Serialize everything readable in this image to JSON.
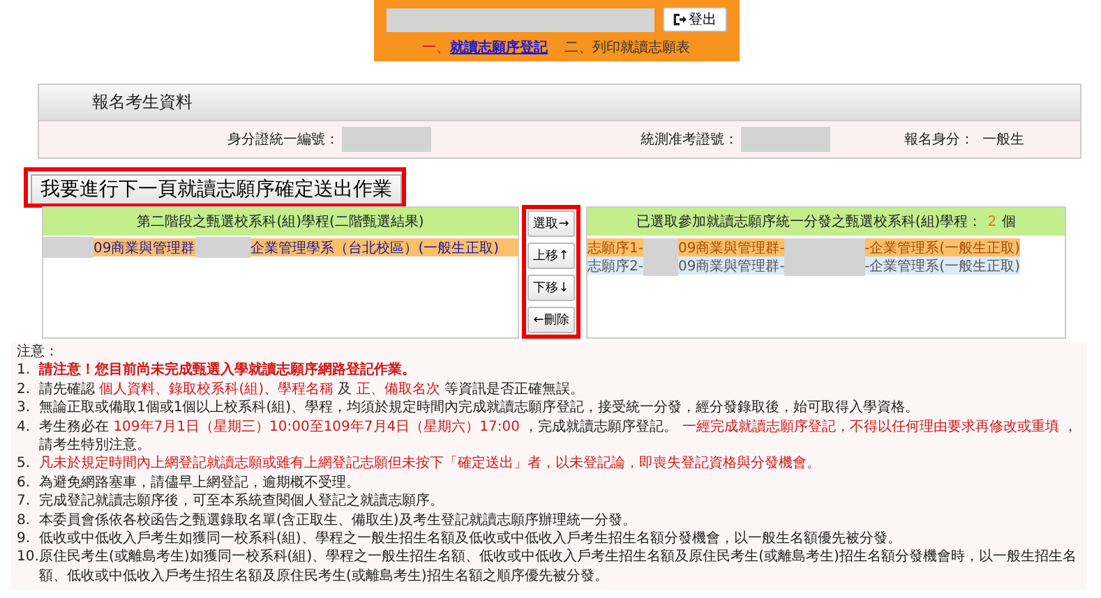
{
  "header": {
    "logout_button": "登出",
    "nav": [
      {
        "number": "一、",
        "label": "就讀志願序登記",
        "selected": true
      },
      {
        "number": "二、",
        "label": "列印就讀志願表",
        "selected": false
      }
    ]
  },
  "profile": {
    "title": "報名考生資料",
    "fields": [
      {
        "label": "身分證統一編號：",
        "redacted": true
      },
      {
        "label": "統測准考證號：",
        "redacted": true
      },
      {
        "label": "報名身分：",
        "value": "一般生",
        "redacted": false
      }
    ]
  },
  "confirm_button": "我要進行下一頁就讀志願序確定送出作業",
  "screening_results": {
    "header": "第二階段之甄選校系科(組)學程(二階甄選結果)",
    "rows": [
      {
        "group": "09商業與管理群",
        "department": "企業管理學系（台北校區）(一般生正取)",
        "selected": true
      }
    ]
  },
  "actions": [
    {
      "label": "選取→"
    },
    {
      "label": "上移↑"
    },
    {
      "label": "下移↓"
    },
    {
      "label": "←刪除"
    }
  ],
  "selected_list": {
    "header": "已選取參加就讀志願序統一分發之甄選校系科(組)學程：",
    "count": "2",
    "count_unit": "個",
    "rows": [
      {
        "prefix": "志願序1-",
        "group": "09商業與管理群-",
        "department": "-企業管理系(一般生正取)",
        "selected": true
      },
      {
        "prefix": "志願序2-",
        "group": "09商業與管理群-",
        "department": "-企業管理系(一般生正取)",
        "selected": false
      }
    ]
  },
  "notes": {
    "title": "注意：",
    "items": [
      {
        "number": "1.",
        "kind": "alert",
        "parts": [
          {
            "text": "請注意！您目前尚未完成甄選入學就讀志願序網路登記作業。",
            "highlight": true
          }
        ]
      },
      {
        "number": "2.",
        "kind": "plain",
        "parts": [
          {
            "text": "請先確認 ",
            "highlight": false
          },
          {
            "text": "個人資料、錄取校系科(組)、學程名稱",
            "highlight": true
          },
          {
            "text": " 及 ",
            "highlight": false
          },
          {
            "text": "正、備取名次",
            "highlight": true
          },
          {
            "text": " 等資訊是否正確無誤。",
            "highlight": false
          }
        ]
      },
      {
        "number": "3.",
        "kind": "plain",
        "parts": [
          {
            "text": "無論正取或備取1個或1個以上校系科(組)、學程，均須於規定時間內完成就讀志願序登記，接受統一分發，經分發錄取後，始可取得入學資格。",
            "highlight": false
          }
        ]
      },
      {
        "number": "4.",
        "kind": "plain",
        "parts": [
          {
            "text": "考生務必在 ",
            "highlight": false
          },
          {
            "text": "109年7月1日（星期三）10:00至109年7月4日（星期六）17:00",
            "highlight": true
          },
          {
            "text": " ，完成就讀志願序登記。 ",
            "highlight": false
          },
          {
            "text": "一經完成就讀志願序登記，不得以任何理由要求再修改或重填",
            "highlight": true
          },
          {
            "text": " ，請考生特別注意。",
            "highlight": false
          }
        ]
      },
      {
        "number": "5.",
        "kind": "plain",
        "parts": [
          {
            "text": "凡未於規定時間內上網登記就讀志願或雖有上網登記志願但未按下「確定送出」者，以未登記論，即喪失登記資格與分發機會。",
            "highlight": true
          }
        ]
      },
      {
        "number": "6.",
        "kind": "plain",
        "parts": [
          {
            "text": "為避免網路塞車，請儘早上網登記，逾期概不受理。",
            "highlight": false
          }
        ]
      },
      {
        "number": "7.",
        "kind": "plain",
        "parts": [
          {
            "text": "完成登記就讀志願序後，可至本系統查閱個人登記之就讀志願序。",
            "highlight": false
          }
        ]
      },
      {
        "number": "8.",
        "kind": "plain",
        "parts": [
          {
            "text": "本委員會係依各校函告之甄選錄取名單(含正取生、備取生)及考生登記就讀志願序辦理統一分發。",
            "highlight": false
          }
        ]
      },
      {
        "number": "9.",
        "kind": "plain",
        "parts": [
          {
            "text": "低收或中低收入戶考生如獲同一校系科(組)、學程之一般生招生名額及低收或中低收入戶考生招生名額分發機會，以一般生名額優先被分發。",
            "highlight": false
          }
        ]
      },
      {
        "number": "10.",
        "kind": "plain",
        "parts": [
          {
            "text": "原住民考生(或離島考生)如獲同一校系科(組)、學程之一般生招生名額、低收或中低收入戶考生招生名額及原住民考生(或離島考生)招生名額分發機會時，以一般生招生名額、低收或中低收入戶考生招生名額及原住民考生(或離島考生)招生名額之順序優先被分發。",
            "highlight": false
          }
        ]
      }
    ]
  }
}
